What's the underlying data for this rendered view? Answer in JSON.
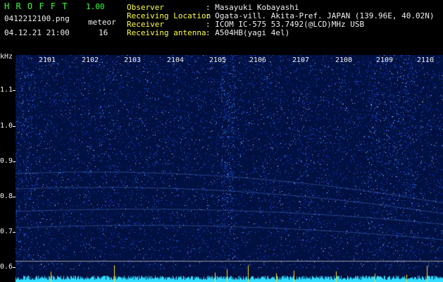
{
  "app": {
    "name": "H R O F F T",
    "version": "1.00",
    "filename": "0412212100.png",
    "datetime": "04.12.21 21:00",
    "meteor_label": "meteor",
    "meteor_count": "16"
  },
  "info": {
    "observer_label": "Observer",
    "observer_value": ": Masayuki Kobayashi",
    "location_label": "Receiving Location",
    "location_value": ": Ogata-vill. Akita-Pref. JAPAN (139.96E, 40.02N)",
    "receiver_label": "Receiver",
    "receiver_value": ": ICOM IC-575 53.7492(@LCD)MHz USB",
    "antenna_label": "Receiving antenna",
    "antenna_value": ": A504HB(yagi 4el)"
  },
  "axis": {
    "unit": "kHz",
    "y_ticks": [
      "1.1",
      "1.0",
      "0.9",
      "0.8",
      "0.7",
      "0.6"
    ],
    "x_ticks": [
      "2101",
      "2102",
      "2103",
      "2104",
      "2105",
      "2106",
      "2107",
      "2108",
      "2109",
      "2110"
    ]
  },
  "colors": {
    "background": "#000000",
    "plot_bg": "#00103a",
    "header_green": "#3cff3c",
    "header_yellow": "#ffff40",
    "bottom_trace": "#33ddff"
  }
}
